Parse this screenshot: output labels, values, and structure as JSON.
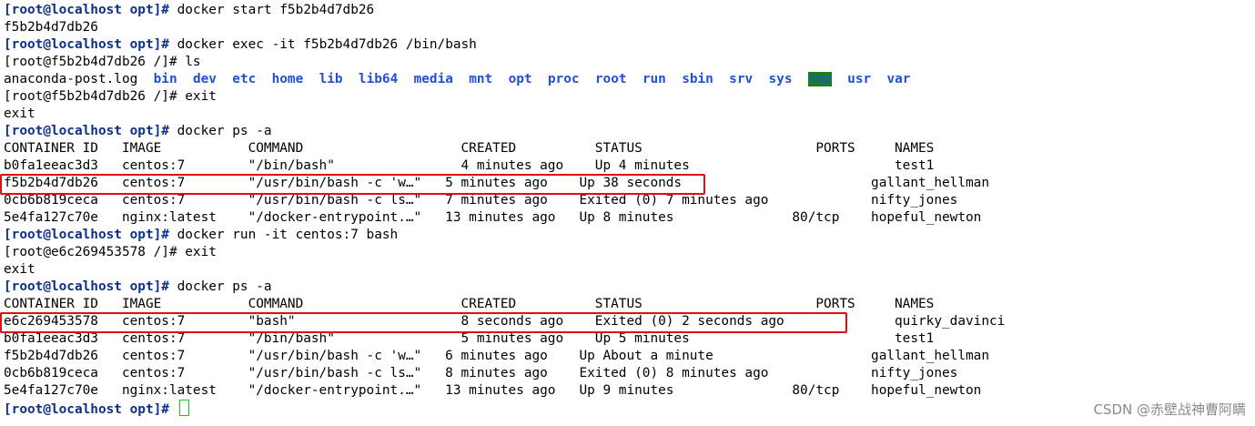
{
  "lines": [
    {
      "prompt": "[root@localhost opt]#",
      "text": " docker start f5b2b4d7db26"
    },
    {
      "text": "f5b2b4d7db26"
    },
    {
      "prompt": "[root@localhost opt]#",
      "text": " docker exec -it f5b2b4d7db26 /bin/bash"
    },
    {
      "text": "[root@f5b2b4d7db26 /]# ls"
    },
    {
      "ls": true
    },
    {
      "text": "[root@f5b2b4d7db26 /]# exit"
    },
    {
      "text": "exit"
    },
    {
      "prompt": "[root@localhost opt]#",
      "text": " docker ps -a"
    },
    {
      "text": "CONTAINER ID   IMAGE           COMMAND                    CREATED          STATUS                      PORTS     NAMES"
    },
    {
      "text": "b0fa1eeac3d3   centos:7        \"/bin/bash\"                4 minutes ago    Up 4 minutes                          test1"
    },
    {
      "text": "f5b2b4d7db26   centos:7        \"/usr/bin/bash -c 'w…\"   5 minutes ago    Up 38 seconds                        gallant_hellman",
      "highlight": true
    },
    {
      "text": "0cb6b819ceca   centos:7        \"/usr/bin/bash -c ls…\"   7 minutes ago    Exited (0) 7 minutes ago             nifty_jones"
    },
    {
      "text": "5e4fa127c70e   nginx:latest    \"/docker-entrypoint.…\"   13 minutes ago   Up 8 minutes               80/tcp    hopeful_newton"
    },
    {
      "prompt": "[root@localhost opt]#",
      "text": " docker run -it centos:7 bash"
    },
    {
      "text": "[root@e6c269453578 /]# exit"
    },
    {
      "text": "exit"
    },
    {
      "prompt": "[root@localhost opt]#",
      "text": " docker ps -a"
    },
    {
      "text": "CONTAINER ID   IMAGE           COMMAND                    CREATED          STATUS                      PORTS     NAMES"
    },
    {
      "text": "e6c269453578   centos:7        \"bash\"                     8 seconds ago    Exited (0) 2 seconds ago              quirky_davinci",
      "highlight": true
    },
    {
      "text": "b0fa1eeac3d3   centos:7        \"/bin/bash\"                5 minutes ago    Up 5 minutes                          test1"
    },
    {
      "text": "f5b2b4d7db26   centos:7        \"/usr/bin/bash -c 'w…\"   6 minutes ago    Up About a minute                    gallant_hellman"
    },
    {
      "text": "0cb6b819ceca   centos:7        \"/usr/bin/bash -c ls…\"   8 minutes ago    Exited (0) 8 minutes ago             nifty_jones"
    },
    {
      "text": "5e4fa127c70e   nginx:latest    \"/docker-entrypoint.…\"   13 minutes ago   Up 9 minutes               80/tcp    hopeful_newton"
    },
    {
      "prompt": "[root@localhost opt]#",
      "text": " ",
      "cursor": true
    }
  ],
  "ls_output": {
    "file": "anaconda-post.log",
    "dirs": [
      "bin",
      "dev",
      "etc",
      "home",
      "lib",
      "lib64",
      "media",
      "mnt",
      "opt",
      "proc",
      "root",
      "run",
      "sbin",
      "srv",
      "sys",
      "tmp",
      "usr",
      "var"
    ]
  },
  "colors": {
    "prompt": "#0b2f8a",
    "directory": "#2050d8",
    "tmp_background": "#1a7f1a",
    "highlight_box": "#e01010",
    "cursor": "#20c020"
  },
  "watermark": "CSDN @赤壁战神曹阿瞒"
}
